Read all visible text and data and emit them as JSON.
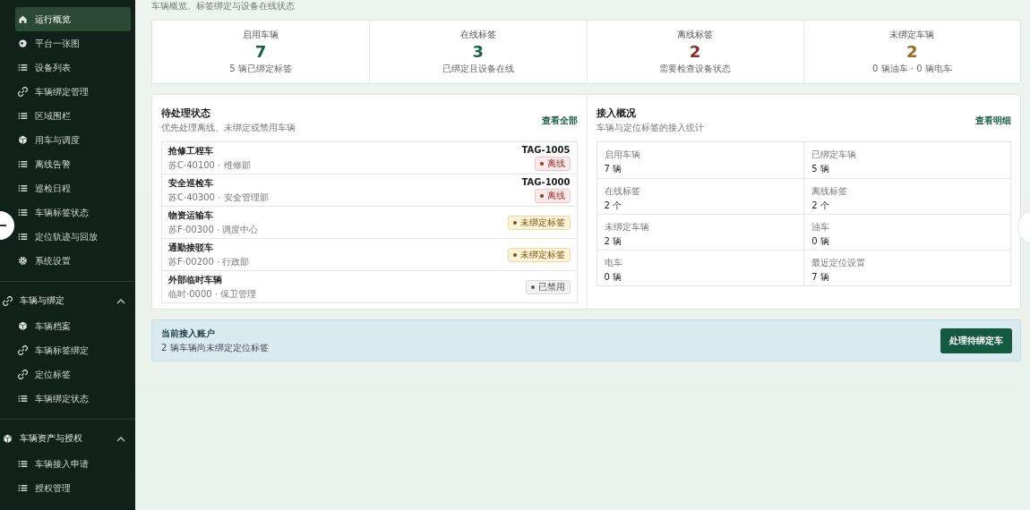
{
  "sidebar": {
    "items": [
      {
        "label": "运行概览",
        "kind": "home",
        "selected": true
      },
      {
        "label": "平台一张图",
        "kind": "globe",
        "selected": false
      },
      {
        "label": "设备列表",
        "kind": "list",
        "selected": false
      },
      {
        "label": "车辆绑定管理",
        "kind": "link",
        "selected": false
      },
      {
        "label": "区域围栏",
        "kind": "list",
        "selected": false
      },
      {
        "label": "用车与调度",
        "kind": "cube",
        "selected": false
      },
      {
        "label": "离线告警",
        "kind": "list",
        "selected": false
      },
      {
        "label": "巡检日程",
        "kind": "list",
        "selected": false
      },
      {
        "label": "车辆标签状态",
        "kind": "list",
        "selected": false
      },
      {
        "label": "定位轨迹与回放",
        "kind": "list",
        "selected": false
      },
      {
        "label": "系统设置",
        "kind": "gear",
        "selected": false
      }
    ],
    "groups": [
      {
        "label": "车辆与绑定",
        "kind": "link",
        "expanded": true,
        "children": [
          {
            "label": "车辆档案",
            "kind": "cube",
            "selected": false
          },
          {
            "label": "车辆标签绑定",
            "kind": "link",
            "selected": false
          },
          {
            "label": "定位标签",
            "kind": "link",
            "selected": false
          },
          {
            "label": "车辆绑定状态",
            "kind": "list",
            "selected": false
          }
        ]
      },
      {
        "label": "车辆资产与授权",
        "kind": "cube",
        "expanded": true,
        "children": [
          {
            "label": "车辆接入申请",
            "kind": "list",
            "selected": false
          },
          {
            "label": "授权管理",
            "kind": "list",
            "selected": false
          }
        ]
      }
    ]
  },
  "subtitle": "车辆概览、标签绑定与设备在线状态",
  "stats": [
    {
      "label": "启用车辆",
      "value": "7",
      "note": "5 辆已绑定标签",
      "color": "#1d5e4a"
    },
    {
      "label": "在线标签",
      "value": "3",
      "note": "已绑定且设备在线",
      "color": "#1d5e4a"
    },
    {
      "label": "离线标签",
      "value": "2",
      "note": "需要检查设备状态",
      "color": "#8b2b2b"
    },
    {
      "label": "未绑定车辆",
      "value": "2",
      "note": "0 辆油车 · 0 辆电车",
      "color": "#9a6a1f"
    }
  ],
  "pending": {
    "title": "待处理状态",
    "subtitle": "优先处理离线、未绑定或禁用车辆",
    "link": "查看全部",
    "rows": [
      {
        "name": "抢修工程车",
        "meta": "苏C·40100 · 维修部",
        "tag": "TAG-1005",
        "status": "离线",
        "kind": "danger"
      },
      {
        "name": "安全巡检车",
        "meta": "苏C·40300 · 安全管理部",
        "tag": "TAG-1000",
        "status": "离线",
        "kind": "danger"
      },
      {
        "name": "物资运输车",
        "meta": "苏F·00300 · 调度中心",
        "status": "未绑定标签",
        "kind": "warning"
      },
      {
        "name": "通勤接驳车",
        "meta": "苏F·00200 · 行政部",
        "status": "未绑定标签",
        "kind": "warning"
      },
      {
        "name": "外部临时车辆",
        "meta": "临时·0000 · 保卫管理",
        "status": "已禁用",
        "kind": "muted"
      }
    ]
  },
  "access": {
    "title": "接入概况",
    "subtitle": "车辆与定位标签的接入统计",
    "link": "查看明细",
    "cells": [
      {
        "label": "启用车辆",
        "value": "7 辆"
      },
      {
        "label": "已绑定车辆",
        "value": "5 辆"
      },
      {
        "label": "在线标签",
        "value": "2 个"
      },
      {
        "label": "离线标签",
        "value": "2 个"
      },
      {
        "label": "未绑定车辆",
        "value": "2 辆"
      },
      {
        "label": "油车",
        "value": "0 辆"
      },
      {
        "label": "电车",
        "value": "0 辆"
      },
      {
        "label": "最近定位设置",
        "value": "7 辆"
      }
    ]
  },
  "banner": {
    "title": "当前接入账户",
    "text": "2 辆车辆尚未绑定定位标签",
    "button": "处理待绑定车"
  }
}
